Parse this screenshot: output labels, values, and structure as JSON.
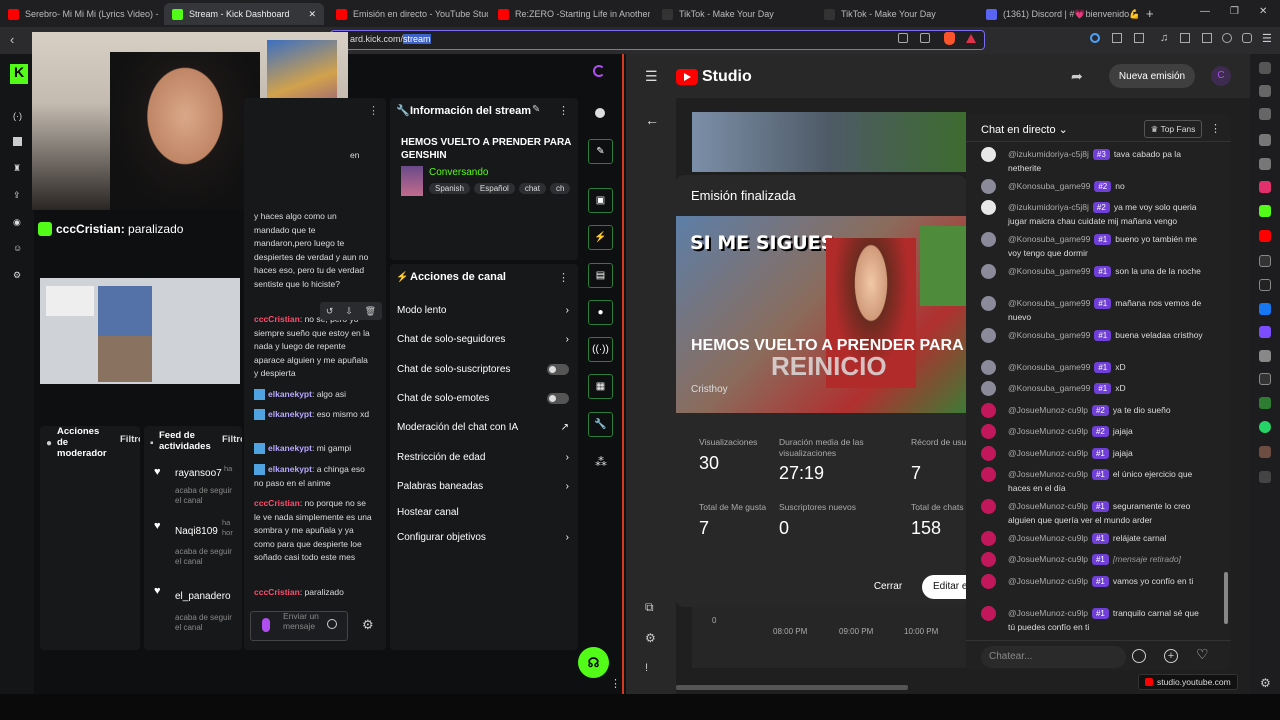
{
  "browser": {
    "tabs": [
      {
        "label": "Serebro- Mi Mi Mi (Lyrics Video) - Yo",
        "color": "#ff0000"
      },
      {
        "label": "Stream - Kick Dashboard",
        "color": "#53fc18"
      },
      {
        "label": "Emisión en directo - YouTube Studio",
        "color": "#ff0000"
      },
      {
        "label": "Re:ZERO -Starting Life in Another W",
        "color": "#ff0000"
      },
      {
        "label": "TikTok - Make Your Day",
        "color": "#111111"
      },
      {
        "label": "TikTok - Make Your Day",
        "color": "#111111"
      },
      {
        "label": "(1361) Discord | #💗bienvenido💪 | E",
        "color": "#5865f2"
      }
    ],
    "url_prefix": "ard.kick.com/",
    "url_selected": "stream",
    "status_url": "studio.youtube.com"
  },
  "kick": {
    "overlay_username": "cccCristian:",
    "overlay_message": "paralizado",
    "chat_partial_top": "en",
    "chat": [
      {
        "user": "",
        "text": "y haces algo como un mandado que te mandaron,pero luego te despiertes de verdad y aun no haces eso, pero tu de verdad sentiste que lo hiciste?"
      },
      {
        "user": "cccCristian",
        "text": "no se, pero yo siempre sueño que estoy en la nada y luego de repente aparace alguien y me apuñala y despierta"
      },
      {
        "user": "elkanekypt",
        "text": "algo asi"
      },
      {
        "user": "elkanekypt",
        "text": "eso mismo xd"
      },
      {
        "user": "elkanekypt",
        "text": "mi gampi"
      },
      {
        "user": "elkanekypt",
        "text": "a chinga eso no paso en el anime"
      },
      {
        "user": "cccCristian",
        "text": "no porque no se le ve nada simplemente es una sombra y me apuñala y ya como para que despierte loe soñado casi todo este mes"
      },
      {
        "user": "cccCristian",
        "text": "paralizado"
      }
    ],
    "chat_input_placeholder": "Enviar un mensaje",
    "stream_info": {
      "title": "Información del stream",
      "stream_title": "HEMOS VUELTO A PRENDER PARA GENSHIN",
      "category": "Conversando",
      "tags": [
        "Spanish",
        "Español",
        "chat",
        "ch"
      ]
    },
    "channel_actions": {
      "title": "Acciones de canal",
      "items": [
        {
          "label": "Modo lento",
          "kind": "arrow"
        },
        {
          "label": "Chat de solo-seguidores",
          "kind": "arrow"
        },
        {
          "label": "Chat de solo-suscriptores",
          "kind": "toggle"
        },
        {
          "label": "Chat de solo-emotes",
          "kind": "toggle"
        },
        {
          "label": "Moderación del chat con IA",
          "kind": "external"
        },
        {
          "label": "Restricción de edad",
          "kind": "arrow"
        },
        {
          "label": "Palabras baneadas",
          "kind": "arrow"
        },
        {
          "label": "Hostear canal",
          "kind": "none"
        },
        {
          "label": "Configurar objetivos",
          "kind": "arrow"
        }
      ]
    },
    "mod_actions": {
      "title": "Acciones de moderador",
      "filter": "Filtro"
    },
    "activity_feed": {
      "title": "Feed de actividades",
      "filter": "Filtro",
      "items": [
        {
          "user": "rayansoo7",
          "time": "ha",
          "action": "acaba de seguir el canal"
        },
        {
          "user": "Naqi8109",
          "time": "ha hor",
          "action": "acaba de seguir el canal"
        },
        {
          "user": "el_panadero",
          "time": "",
          "action": "acaba de seguir el canal"
        }
      ]
    }
  },
  "youtube": {
    "logo_text": "Studio",
    "new_stream_button": "Nueva emisión",
    "ended_title": "Emisión finalizada",
    "video_title": "HEMOS VUELTO A PRENDER PARA MINECRAFT",
    "thumb_text_top": "SI ME SIGUES",
    "thumb_text_bottom": "REINICIO",
    "channel": "Cristhoy",
    "stats": [
      {
        "label": "Visualizaciones",
        "value": "30"
      },
      {
        "label": "Duración media de las visualizaciones",
        "value": "27:19"
      },
      {
        "label": "Récord de usua vez",
        "value": "7"
      },
      {
        "label": "Total de Me gusta",
        "value": "7"
      },
      {
        "label": "Suscriptores nuevos",
        "value": "0"
      },
      {
        "label": "Total de chats",
        "value": "158"
      }
    ],
    "close_button": "Cerrar",
    "edit_button": "Editar e",
    "graph_labels": [
      "0",
      "08:00 PM",
      "09:00 PM",
      "10:00 PM"
    ],
    "chat": {
      "title": "Chat en directo",
      "top_fans": "Top Fans",
      "input_placeholder": "Chatear...",
      "messages": [
        {
          "user": "@izukumidoriya-c5j8j",
          "badge": "#3",
          "text": "tava cabado pa la netherite",
          "avatar": "#e8e8e8"
        },
        {
          "user": "@Konosuba_game99",
          "badge": "#2",
          "text": "no",
          "avatar": "#8a8a9a"
        },
        {
          "user": "@izukumidoriya-c5j8j",
          "badge": "#2",
          "text": "ya me voy solo queria jugar maicra chau cuidate mij mañana vengo",
          "avatar": "#e8e8e8"
        },
        {
          "user": "@Konosuba_game99",
          "badge": "#1",
          "text": "bueno yo también me voy tengo que dormir",
          "avatar": "#8a8a9a"
        },
        {
          "user": "@Konosuba_game99",
          "badge": "#1",
          "text": "son la una de la noche",
          "avatar": "#8a8a9a"
        },
        {
          "user": "@Konosuba_game99",
          "badge": "#1",
          "text": "mañana nos vemos de nuevo",
          "avatar": "#8a8a9a"
        },
        {
          "user": "@Konosuba_game99",
          "badge": "#1",
          "text": "buena veladaa cristhoy",
          "avatar": "#8a8a9a"
        },
        {
          "user": "@Konosuba_game99",
          "badge": "#1",
          "text": "xD",
          "avatar": "#8a8a9a"
        },
        {
          "user": "@Konosuba_game99",
          "badge": "#1",
          "text": "xD",
          "avatar": "#8a8a9a"
        },
        {
          "user": "@JosueMunoz-cu9lp",
          "badge": "#2",
          "text": "ya te dio sueño",
          "avatar": "#c2185b"
        },
        {
          "user": "@JosueMunoz-cu9lp",
          "badge": "#2",
          "text": "jajaja",
          "avatar": "#c2185b"
        },
        {
          "user": "@JosueMunoz-cu9lp",
          "badge": "#1",
          "text": "jajaja",
          "avatar": "#c2185b"
        },
        {
          "user": "@JosueMunoz-cu9lp",
          "badge": "#1",
          "text": "el único ejercicio que haces en el día",
          "avatar": "#c2185b"
        },
        {
          "user": "@JosueMunoz-cu9lp",
          "badge": "#1",
          "text": "seguramente lo creo alguien que quería ver el mundo arder",
          "avatar": "#c2185b"
        },
        {
          "user": "@JosueMunoz-cu9lp",
          "badge": "#1",
          "text": "relájate carnal",
          "avatar": "#c2185b"
        },
        {
          "user": "@JosueMunoz-cu9lp",
          "badge": "#1",
          "text": "[mensaje retirado]",
          "avatar": "#c2185b"
        },
        {
          "user": "@JosueMunoz-cu9lp",
          "badge": "#1",
          "text": "vamos yo confío en ti",
          "avatar": "#c2185b"
        },
        {
          "user": "@JosueMunoz-cu9lp",
          "badge": "#1",
          "text": "tranquilo carnal sé que tú puedes confío en ti",
          "avatar": "#c2185b"
        }
      ]
    }
  }
}
